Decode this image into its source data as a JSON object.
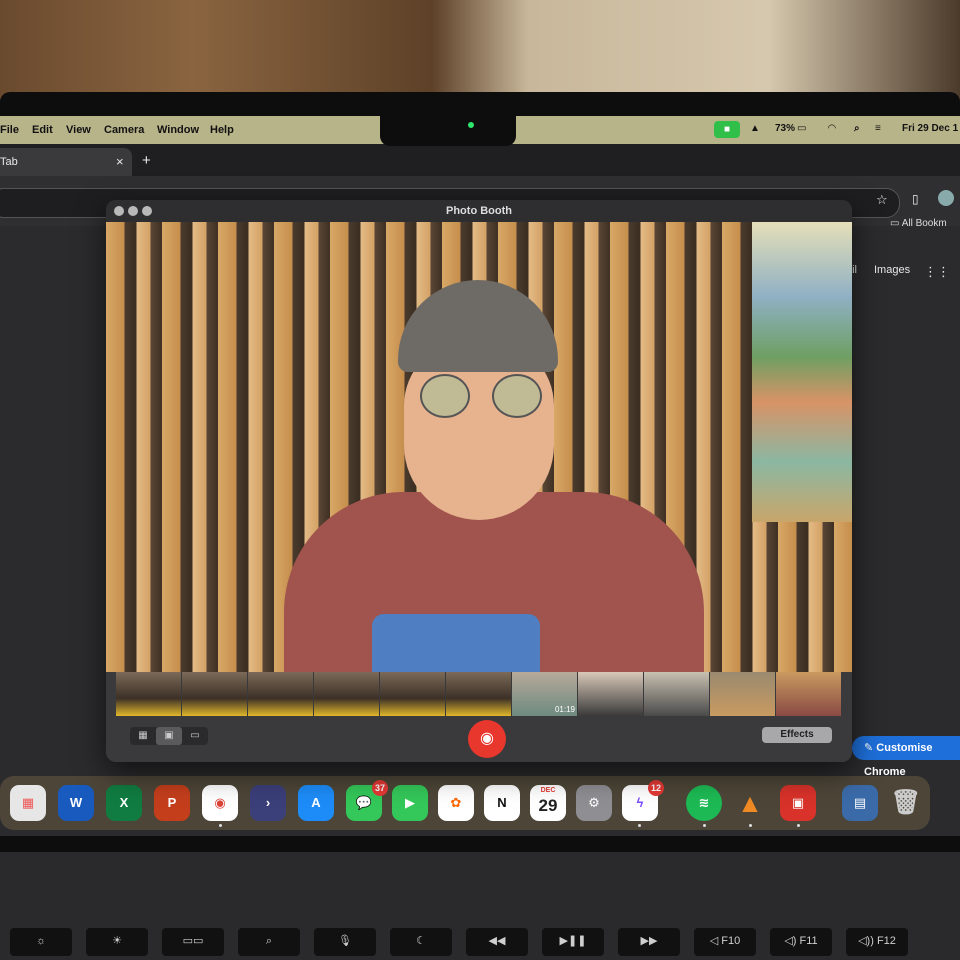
{
  "menubar": {
    "items": [
      "File",
      "Edit",
      "View",
      "Camera",
      "Window",
      "Help"
    ],
    "battery": "73%",
    "clock": "Fri 29 Dec 1"
  },
  "browser": {
    "tab_title": "Tab",
    "tab_close": "×",
    "new_tab": "+",
    "bookmarks_label": "All Bookm",
    "google_links": [
      "ail",
      "Images"
    ],
    "customise_button": "Customise Chrome"
  },
  "photobooth": {
    "title": "Photo Booth",
    "thumbnail_timestamp": "01:19",
    "effects_button": "Effects"
  },
  "dock": {
    "calendar_month": "DEC",
    "calendar_day": "29",
    "messages_badge": "37",
    "messenger_badge": "12",
    "apps": [
      "Launchpad",
      "Microsoft Word",
      "Microsoft Excel",
      "Microsoft PowerPoint",
      "Google Chrome",
      "Terminal",
      "App Store",
      "Messages",
      "FaceTime",
      "Photos",
      "Notion",
      "Calendar",
      "System Settings",
      "Messenger",
      "Spotify",
      "VLC",
      "Photo Booth",
      "Downloads",
      "Trash"
    ]
  },
  "keyboard": {
    "keys": [
      "F10",
      "F11",
      "F12"
    ]
  },
  "colors": {
    "menubar": "#b8b48a",
    "shutter": "#e8372c",
    "customise": "#1e6fd9",
    "facetime": "#30c04a"
  }
}
